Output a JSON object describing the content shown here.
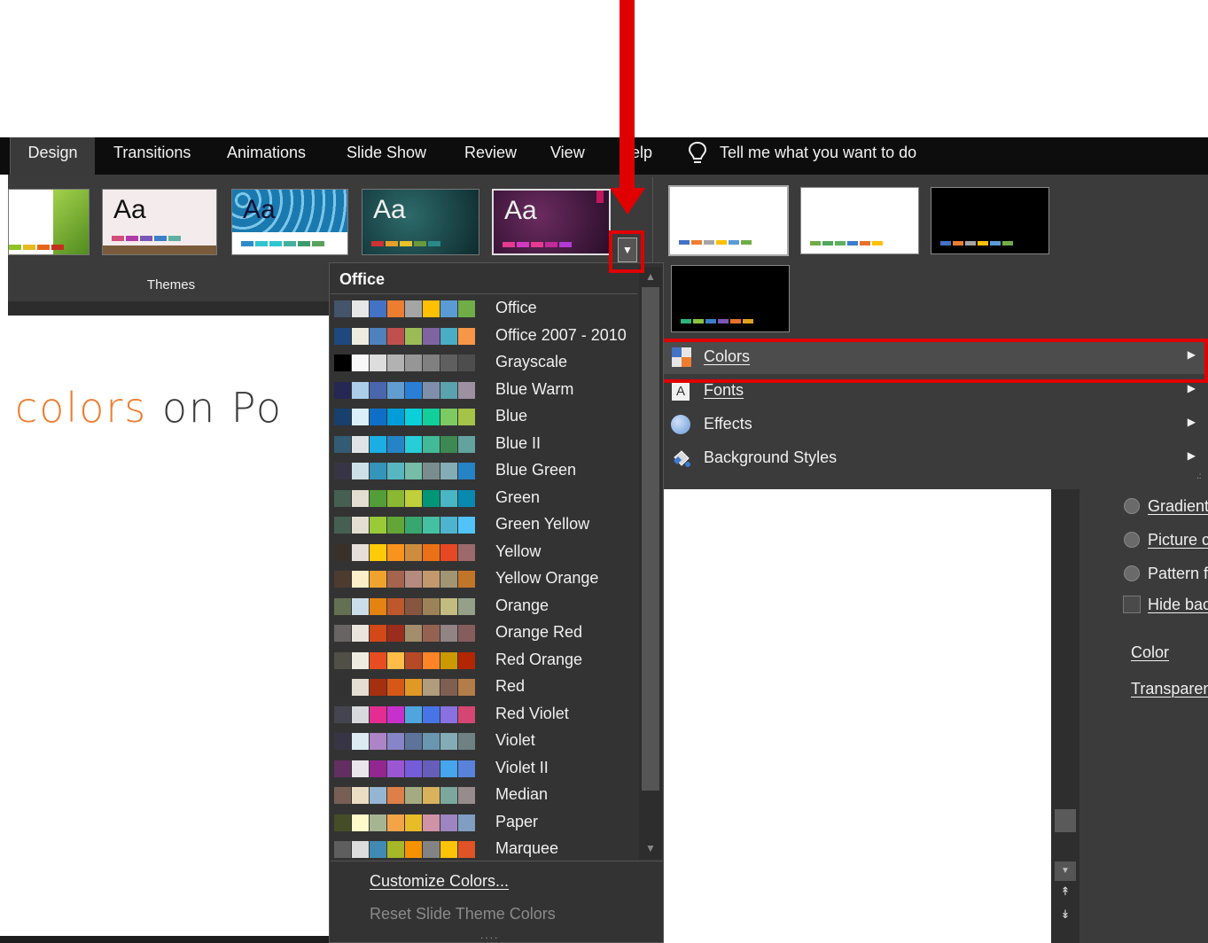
{
  "tabs": [
    {
      "label": "Design",
      "active": true
    },
    {
      "label": "Transitions"
    },
    {
      "label": "Animations"
    },
    {
      "label": "Slide Show"
    },
    {
      "label": "Review"
    },
    {
      "label": "View"
    },
    {
      "label": "elp"
    }
  ],
  "tell_me": "Tell me what you want to do",
  "ribbon": {
    "themes_label": "Themes",
    "theme_thumb_text": "Aa"
  },
  "slide": {
    "title_highlight": "colors",
    "title_rest": " on Po"
  },
  "colors_dropdown": {
    "header": "Office",
    "schemes": [
      {
        "name": "Office",
        "swatches": [
          "#44546a",
          "#e7e6e6",
          "#4472c4",
          "#ed7d31",
          "#a5a5a5",
          "#ffc000",
          "#5b9bd5",
          "#70ad47"
        ]
      },
      {
        "name": "Office 2007 - 2010",
        "swatches": [
          "#1f497d",
          "#eeece1",
          "#4f81bd",
          "#c0504d",
          "#9bbb59",
          "#8064a2",
          "#4bacc6",
          "#f79646"
        ]
      },
      {
        "name": "Grayscale",
        "swatches": [
          "#000000",
          "#f8f8f8",
          "#dddddd",
          "#b2b2b2",
          "#969696",
          "#808080",
          "#5f5f5f",
          "#4d4d4d"
        ]
      },
      {
        "name": "Blue Warm",
        "swatches": [
          "#242852",
          "#acccea",
          "#4a66ac",
          "#629dd1",
          "#297fd5",
          "#7f8fa9",
          "#5aa2ae",
          "#9d90a0"
        ]
      },
      {
        "name": "Blue",
        "swatches": [
          "#17406d",
          "#dbeff9",
          "#0f6fc6",
          "#009dd9",
          "#0bd0d9",
          "#10cf9b",
          "#7cca62",
          "#a5c249"
        ]
      },
      {
        "name": "Blue II",
        "swatches": [
          "#335b74",
          "#dfe3e5",
          "#1cade4",
          "#2683c6",
          "#27ced7",
          "#42ba97",
          "#3e8853",
          "#62a39f"
        ]
      },
      {
        "name": "Blue Green",
        "swatches": [
          "#373545",
          "#cee0e7",
          "#3494ba",
          "#58b6c0",
          "#75bda7",
          "#7a8c8e",
          "#84acb6",
          "#2683c6"
        ]
      },
      {
        "name": "Green",
        "swatches": [
          "#455f51",
          "#e3ded1",
          "#549e39",
          "#8ab833",
          "#c0cf3a",
          "#029676",
          "#4ab5c4",
          "#0989b1"
        ]
      },
      {
        "name": "Green Yellow",
        "swatches": [
          "#455f51",
          "#e3ded1",
          "#99cb38",
          "#63a537",
          "#37a76f",
          "#44c1a3",
          "#4eb3cf",
          "#51c3f9"
        ]
      },
      {
        "name": "Yellow",
        "swatches": [
          "#39302a",
          "#e5dedb",
          "#ffca08",
          "#f8931d",
          "#ce8d3e",
          "#ec7016",
          "#e64823",
          "#9c6a6a"
        ]
      },
      {
        "name": "Yellow Orange",
        "swatches": [
          "#4e3b30",
          "#fbeec9",
          "#f0a22e",
          "#a5644e",
          "#b58b80",
          "#c3986d",
          "#a19574",
          "#c17529"
        ]
      },
      {
        "name": "Orange",
        "swatches": [
          "#637052",
          "#ccddea",
          "#e48312",
          "#bd582c",
          "#865640",
          "#9b8357",
          "#c2bc80",
          "#94a088"
        ]
      },
      {
        "name": "Orange Red",
        "swatches": [
          "#696464",
          "#e9e5dc",
          "#d34817",
          "#9b2d1f",
          "#a28e6a",
          "#956251",
          "#918485",
          "#855d5d"
        ]
      },
      {
        "name": "Red Orange",
        "swatches": [
          "#505046",
          "#eeece1",
          "#e84c22",
          "#ffbd47",
          "#b64926",
          "#ff8427",
          "#cc9900",
          "#b22600"
        ]
      },
      {
        "name": "Red",
        "swatches": [
          "#323232",
          "#e3ded1",
          "#a5300f",
          "#d55816",
          "#e19825",
          "#b19c7d",
          "#7f5f52",
          "#b27d49"
        ]
      },
      {
        "name": "Red Violet",
        "swatches": [
          "#454551",
          "#d8d9dc",
          "#e32d91",
          "#c830cc",
          "#4ea6dc",
          "#4775e7",
          "#8971e1",
          "#d54773"
        ]
      },
      {
        "name": "Violet",
        "swatches": [
          "#373545",
          "#dceaf2",
          "#ad84c6",
          "#8784c7",
          "#5d739a",
          "#6997af",
          "#84acb6",
          "#6f8183"
        ]
      },
      {
        "name": "Violet II",
        "swatches": [
          "#632e62",
          "#eae5eb",
          "#92278f",
          "#9b57d3",
          "#755dd9",
          "#665eb8",
          "#45a5ed",
          "#5982db"
        ]
      },
      {
        "name": "Median",
        "swatches": [
          "#775f55",
          "#ebddc3",
          "#94b6d2",
          "#dd8047",
          "#a5ab81",
          "#d8b25c",
          "#7ba79d",
          "#968c8c"
        ]
      },
      {
        "name": "Paper",
        "swatches": [
          "#444d26",
          "#fefac9",
          "#a5b592",
          "#f3a447",
          "#e7bc29",
          "#d092a7",
          "#9c85c0",
          "#809ec2"
        ]
      },
      {
        "name": "Marquee",
        "swatches": [
          "#5e5e5e",
          "#dddddd",
          "#418ab3",
          "#a6b727",
          "#f69200",
          "#838383",
          "#fec306",
          "#df5327"
        ]
      }
    ],
    "customize": "Customize Colors...",
    "reset": "Reset Slide Theme Colors",
    "grip": "...."
  },
  "variants_menu": {
    "items": [
      {
        "label": "Colors",
        "icon": "colors-icon"
      },
      {
        "label": "Fonts",
        "icon": "fonts-icon",
        "icon_text": "A"
      },
      {
        "label": "Effects",
        "icon": "effects-icon"
      },
      {
        "label": "Background Styles",
        "icon": "background-styles-icon"
      }
    ]
  },
  "format_pane": {
    "options": [
      "Gradient",
      "Picture c",
      "Pattern f"
    ],
    "hide": "Hide bac",
    "color": "Color",
    "transparency": "Transparen"
  },
  "annotation_color": "#e00000"
}
